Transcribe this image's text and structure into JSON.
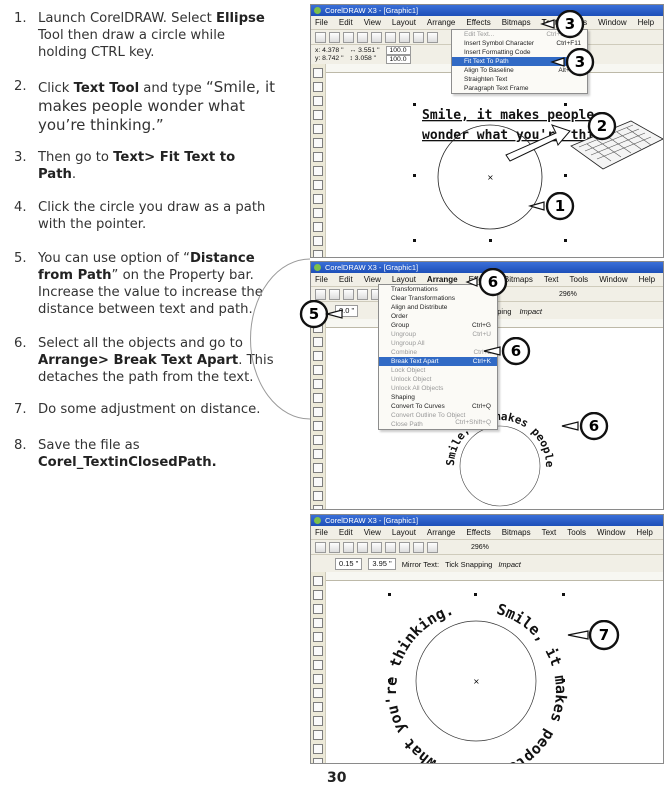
{
  "steps": [
    {
      "n": "1.",
      "pre": "Launch CorelDRAW. Select ",
      "b": "Ellipse",
      "post": " Tool then draw a circle while holding CTRL key."
    },
    {
      "n": "2.",
      "pre": "Click ",
      "b": "Text Tool",
      "post": " and type ",
      "quote": "“Smile, it makes people wonder what you’re thinking.”"
    },
    {
      "n": "3.",
      "pre": "Then go to ",
      "b": "Text> Fit Text to Path",
      "post": "."
    },
    {
      "n": "4.",
      "pre": "Click the circle you draw as a path with the pointer.",
      "b": "",
      "post": ""
    },
    {
      "n": "5.",
      "pre": "You can use option of “",
      "b": "Distance from Path",
      "post": "” on the Property bar. Increase the value to increase the distance between text and path."
    },
    {
      "n": "6.",
      "pre": "Select all the objects and go to ",
      "b": "Arrange> Break Text Apart",
      "post": ". This detaches the path from the text."
    },
    {
      "n": "7.",
      "pre": "Do some adjustment on distance.",
      "b": "",
      "post": ""
    },
    {
      "n": "8.",
      "pre": "Save the file as ",
      "b": "Corel_TextinClosedPath.",
      "post": ""
    }
  ],
  "window_title": "CorelDRAW X3 - [Graphic1]",
  "menus": [
    "File",
    "Edit",
    "View",
    "Layout",
    "Arrange",
    "Effects",
    "Bitmaps",
    "Text",
    "Tools",
    "Window",
    "Help"
  ],
  "shot1": {
    "x_field": "x: 4.378 \"",
    "y_field": "y: 8.742 \"",
    "w_field": "↔ 3.551 \"",
    "h_field": "↕ 3.058 \"",
    "pct1": "100.0",
    "pct2": "100.0",
    "text_menu": [
      "Edit Text...",
      "Insert Symbol Character",
      "Insert Formatting Code",
      "Fit Text To Path",
      "Align To Baseline",
      "Straighten Text",
      "Paragraph Text Frame"
    ],
    "shortcuts": [
      "Ctrl+Shift+T",
      "Ctrl+F11",
      "",
      "",
      "Alt+F12",
      "",
      ""
    ],
    "sample_line1": "Smile, it makes people",
    "sample_line2": "wonder what you're thinking."
  },
  "shot2": {
    "offset": "0.0 \"",
    "zoom": "296%",
    "snap": "Tick Snapping",
    "font": "Impact",
    "arrange_menu": [
      "Transformations",
      "Clear Transformations",
      "Align and Distribute",
      "Order",
      "Group",
      "Ungroup",
      "Ungroup All",
      "Combine",
      "Break Text Apart",
      "Lock Object",
      "Unlock Object",
      "Unlock All Objects",
      "Shaping",
      "Convert To Curves",
      "Convert Outline To Object",
      "Close Path"
    ],
    "arrange_shortcuts": [
      "",
      "",
      "",
      "",
      "Ctrl+G",
      "Ctrl+U",
      "",
      "Ctrl+L",
      "Ctrl+K",
      "",
      "",
      "",
      "",
      "Ctrl+Q",
      "Ctrl+Shift+Q",
      ""
    ]
  },
  "shot3": {
    "offset": "0.15 \"",
    "distance": "3.95 \"",
    "zoom": "296%",
    "mirror": "Mirror Text:",
    "snap": "Tick Snapping",
    "font": "Impact"
  },
  "arc_text": "Smile, it makes people wonder what you're thinking.",
  "callouts": [
    "3",
    "3",
    "2",
    "1",
    "6",
    "5",
    "6",
    "6",
    "7"
  ],
  "page_number": "30",
  "colors": {
    "callout_fill": "#ffffff",
    "callout_stroke": "#111111",
    "menu_highlight": "#316ac5"
  }
}
